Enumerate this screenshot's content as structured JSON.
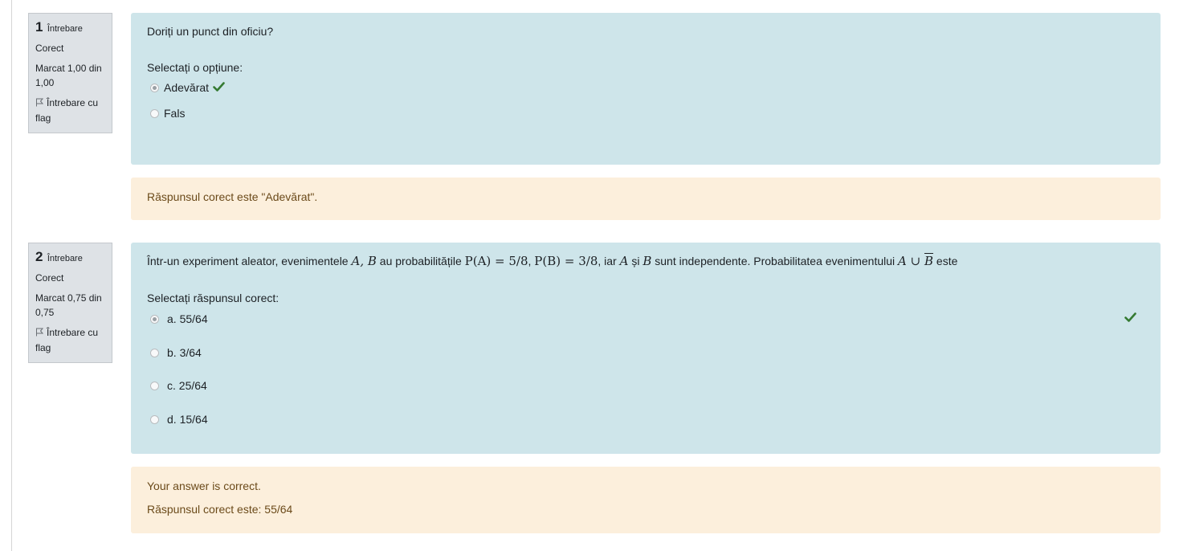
{
  "colors": {
    "info_bg": "#dee2e6",
    "formulation_bg": "#cee5ea",
    "feedback_bg": "#fcefdc",
    "correct_check": "#357a32",
    "feedback_text": "#6b4a1a"
  },
  "questions": [
    {
      "info": {
        "number": "1",
        "label": "Întrebare",
        "state": "Corect",
        "grade": "Marcat 1,00 din 1,00",
        "flag_label": "Întrebare cu flag",
        "flag_icon": "flag-icon"
      },
      "text": "Doriți un punct din oficiu?",
      "prompt": "Selectați o opțiune:",
      "options": [
        {
          "label": "Adevărat",
          "checked": true,
          "marked_correct": true
        },
        {
          "label": "Fals",
          "checked": false,
          "marked_correct": false
        }
      ],
      "feedback": {
        "right_answer": "Răspunsul corect este \"Adevărat\"."
      }
    },
    {
      "info": {
        "number": "2",
        "label": "Întrebare",
        "state": "Corect",
        "grade": "Marcat 0,75 din 0,75",
        "flag_label": "Întrebare cu flag",
        "flag_icon": "flag-icon"
      },
      "text_parts": {
        "intro": "Într-un experiment aleator,  evenimentele ",
        "events": "A, B",
        "mid1": " au probabilitățile ",
        "pa": "P(A) = 5/8",
        "sep": ",  ",
        "pb": "P(B) = 3/8",
        "mid2": ", iar ",
        "a": "A",
        "si": " și ",
        "b": "B",
        "mid3": " sunt independente.  Probabilitatea evenimentului ",
        "union_a": "A ∪ ",
        "union_b": "B",
        "end": " este"
      },
      "prompt": "Selectați răspunsul corect:",
      "options": [
        {
          "label": "a. 55/64",
          "checked": true,
          "marked_correct": true
        },
        {
          "label": "b. 3/64",
          "checked": false,
          "marked_correct": false
        },
        {
          "label": "c. 25/64",
          "checked": false,
          "marked_correct": false
        },
        {
          "label": "d. 15/64",
          "checked": false,
          "marked_correct": false
        }
      ],
      "feedback": {
        "specific": "Your answer is correct.",
        "right_answer": "Răspunsul corect este: 55/64"
      },
      "check_icon": "check-icon"
    }
  ]
}
